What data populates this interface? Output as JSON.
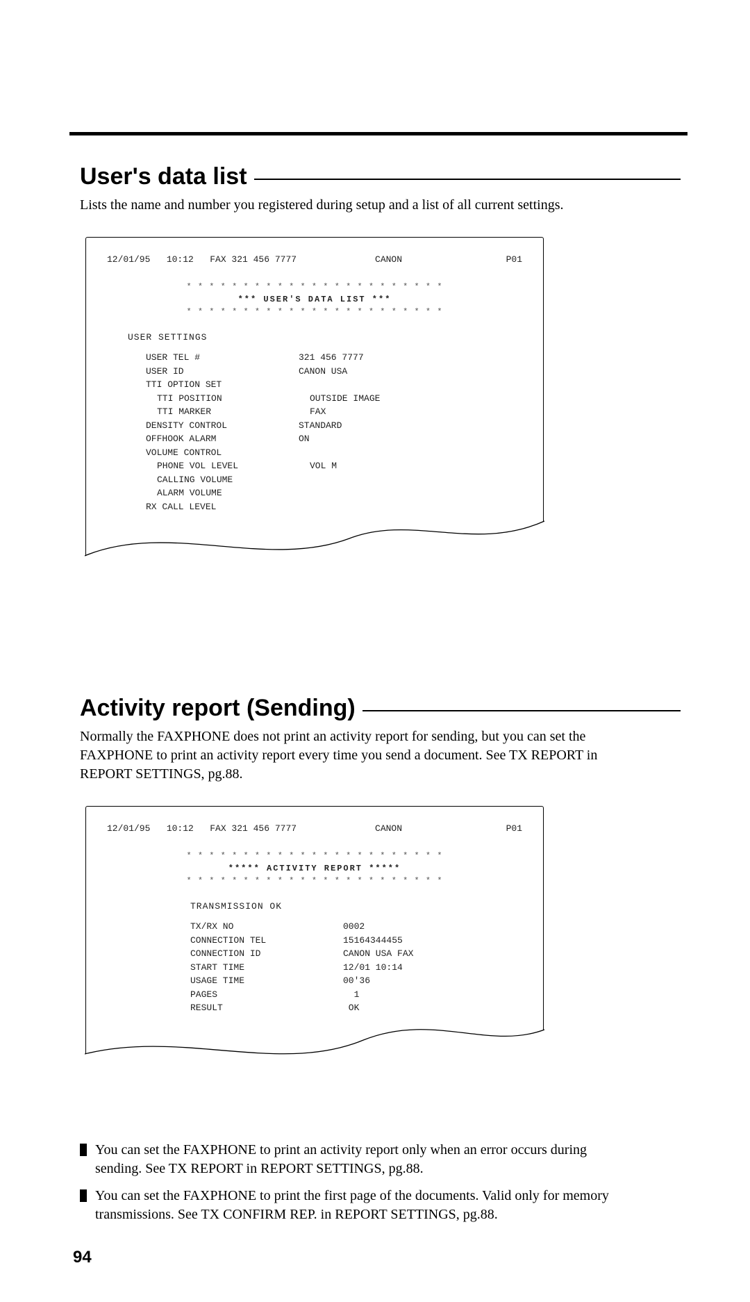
{
  "sections": {
    "users_data_list": {
      "title": "User's data list",
      "description": "Lists the name and number you registered during setup and a list of all current settings."
    },
    "activity_report": {
      "title": "Activity report (Sending)",
      "description": "Normally the FAXPHONE does not print an activity report for sending, but you can set the FAXPHONE to print an activity report every time you send a document.  See TX REPORT in REPORT SETTINGS, pg.88."
    }
  },
  "printout1": {
    "header": {
      "left": "12/01/95   10:12   FAX 321 456 7777",
      "middle": "CANON",
      "right": "P01"
    },
    "center_lines": {
      "top": "* * * * * * * * * * * * * * * * * * * * * * *",
      "mid": "***  USER'S  DATA  LIST  ***",
      "bot": "* * * * * * * * * * * * * * * * * * * * * * *"
    },
    "group_title": "USER SETTINGS",
    "rows": [
      {
        "k": "USER TEL #",
        "v": "321 456 7777",
        "indent": false
      },
      {
        "k": "USER ID",
        "v": "CANON USA",
        "indent": false
      },
      {
        "k": "TTI OPTION SET",
        "v": "",
        "indent": false
      },
      {
        "k": "TTI POSITION",
        "v": "OUTSIDE IMAGE",
        "indent": true
      },
      {
        "k": "TTI MARKER",
        "v": "FAX",
        "indent": true
      },
      {
        "k": "DENSITY CONTROL",
        "v": "STANDARD",
        "indent": false
      },
      {
        "k": "OFFHOOK ALARM",
        "v": "ON",
        "indent": false
      },
      {
        "k": "VOLUME CONTROL",
        "v": "",
        "indent": false
      },
      {
        "k": "PHONE VOL LEVEL",
        "v": "VOL M",
        "indent": true
      },
      {
        "k": "CALLING VOLUME",
        "v": "",
        "indent": true
      },
      {
        "k": "ALARM VOLUME",
        "v": "",
        "indent": true
      },
      {
        "k": "RX CALL LEVEL",
        "v": "",
        "indent": false
      }
    ]
  },
  "printout2": {
    "header": {
      "left": "12/01/95   10:12   FAX 321 456 7777",
      "middle": "CANON",
      "right": "P01"
    },
    "center_lines": {
      "top": "* * * * * * * * * * * * * * * * * * * * * * *",
      "mid": "*****  ACTIVITY REPORT  *****",
      "bot": "* * * * * * * * * * * * * * * * * * * * * * *"
    },
    "group_title": "TRANSMISSION OK",
    "rows": [
      {
        "k": "TX/RX NO",
        "v": "0002",
        "indent": false
      },
      {
        "k": "CONNECTION TEL",
        "v": "15164344455",
        "indent": false
      },
      {
        "k": "CONNECTION ID",
        "v": "CANON USA FAX",
        "indent": false
      },
      {
        "k": "START TIME",
        "v": "12/01 10:14",
        "indent": false
      },
      {
        "k": "USAGE TIME",
        "v": "00'36",
        "indent": false
      },
      {
        "k": "PAGES",
        "v": "  1",
        "indent": false
      },
      {
        "k": "RESULT",
        "v": " OK",
        "indent": false
      }
    ]
  },
  "notes": [
    "You can set the FAXPHONE to print an activity report only when an error occurs during sending.  See TX REPORT in REPORT SETTINGS, pg.88.",
    "You can set the FAXPHONE to print the first page of the documents. Valid only for memory transmissions. See TX CONFIRM REP. in REPORT SETTINGS, pg.88."
  ],
  "page_number": "94"
}
